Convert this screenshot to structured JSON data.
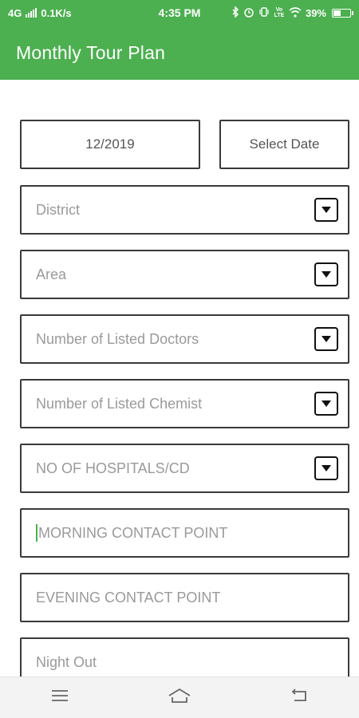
{
  "status_bar": {
    "network": "4G",
    "speed": "0.1K/s",
    "time": "4:35 PM",
    "volte": "Vo LTE",
    "battery": "39%",
    "battery_level": 0.39,
    "icons": [
      "bluetooth-icon",
      "alarm-icon",
      "vibrate-icon",
      "wifi-icon"
    ]
  },
  "app_bar": {
    "title": "Monthly Tour Plan",
    "color": "#4caf50"
  },
  "form": {
    "month_value": "12/2019",
    "select_date_label": "Select Date",
    "fields": [
      {
        "placeholder": "District",
        "type": "dropdown"
      },
      {
        "placeholder": "Area",
        "type": "dropdown"
      },
      {
        "placeholder": "Number of Listed Doctors",
        "type": "dropdown"
      },
      {
        "placeholder": "Number of Listed Chemist",
        "type": "dropdown"
      },
      {
        "placeholder": "NO OF HOSPITALS/CD",
        "type": "dropdown"
      },
      {
        "placeholder": "MORNING CONTACT POINT",
        "type": "text",
        "focused": true
      },
      {
        "placeholder": "EVENING CONTACT POINT",
        "type": "text"
      },
      {
        "placeholder": "Night Out",
        "type": "text"
      }
    ]
  },
  "nav_bar": {
    "icons": [
      "menu-icon",
      "home-icon",
      "back-icon"
    ]
  }
}
